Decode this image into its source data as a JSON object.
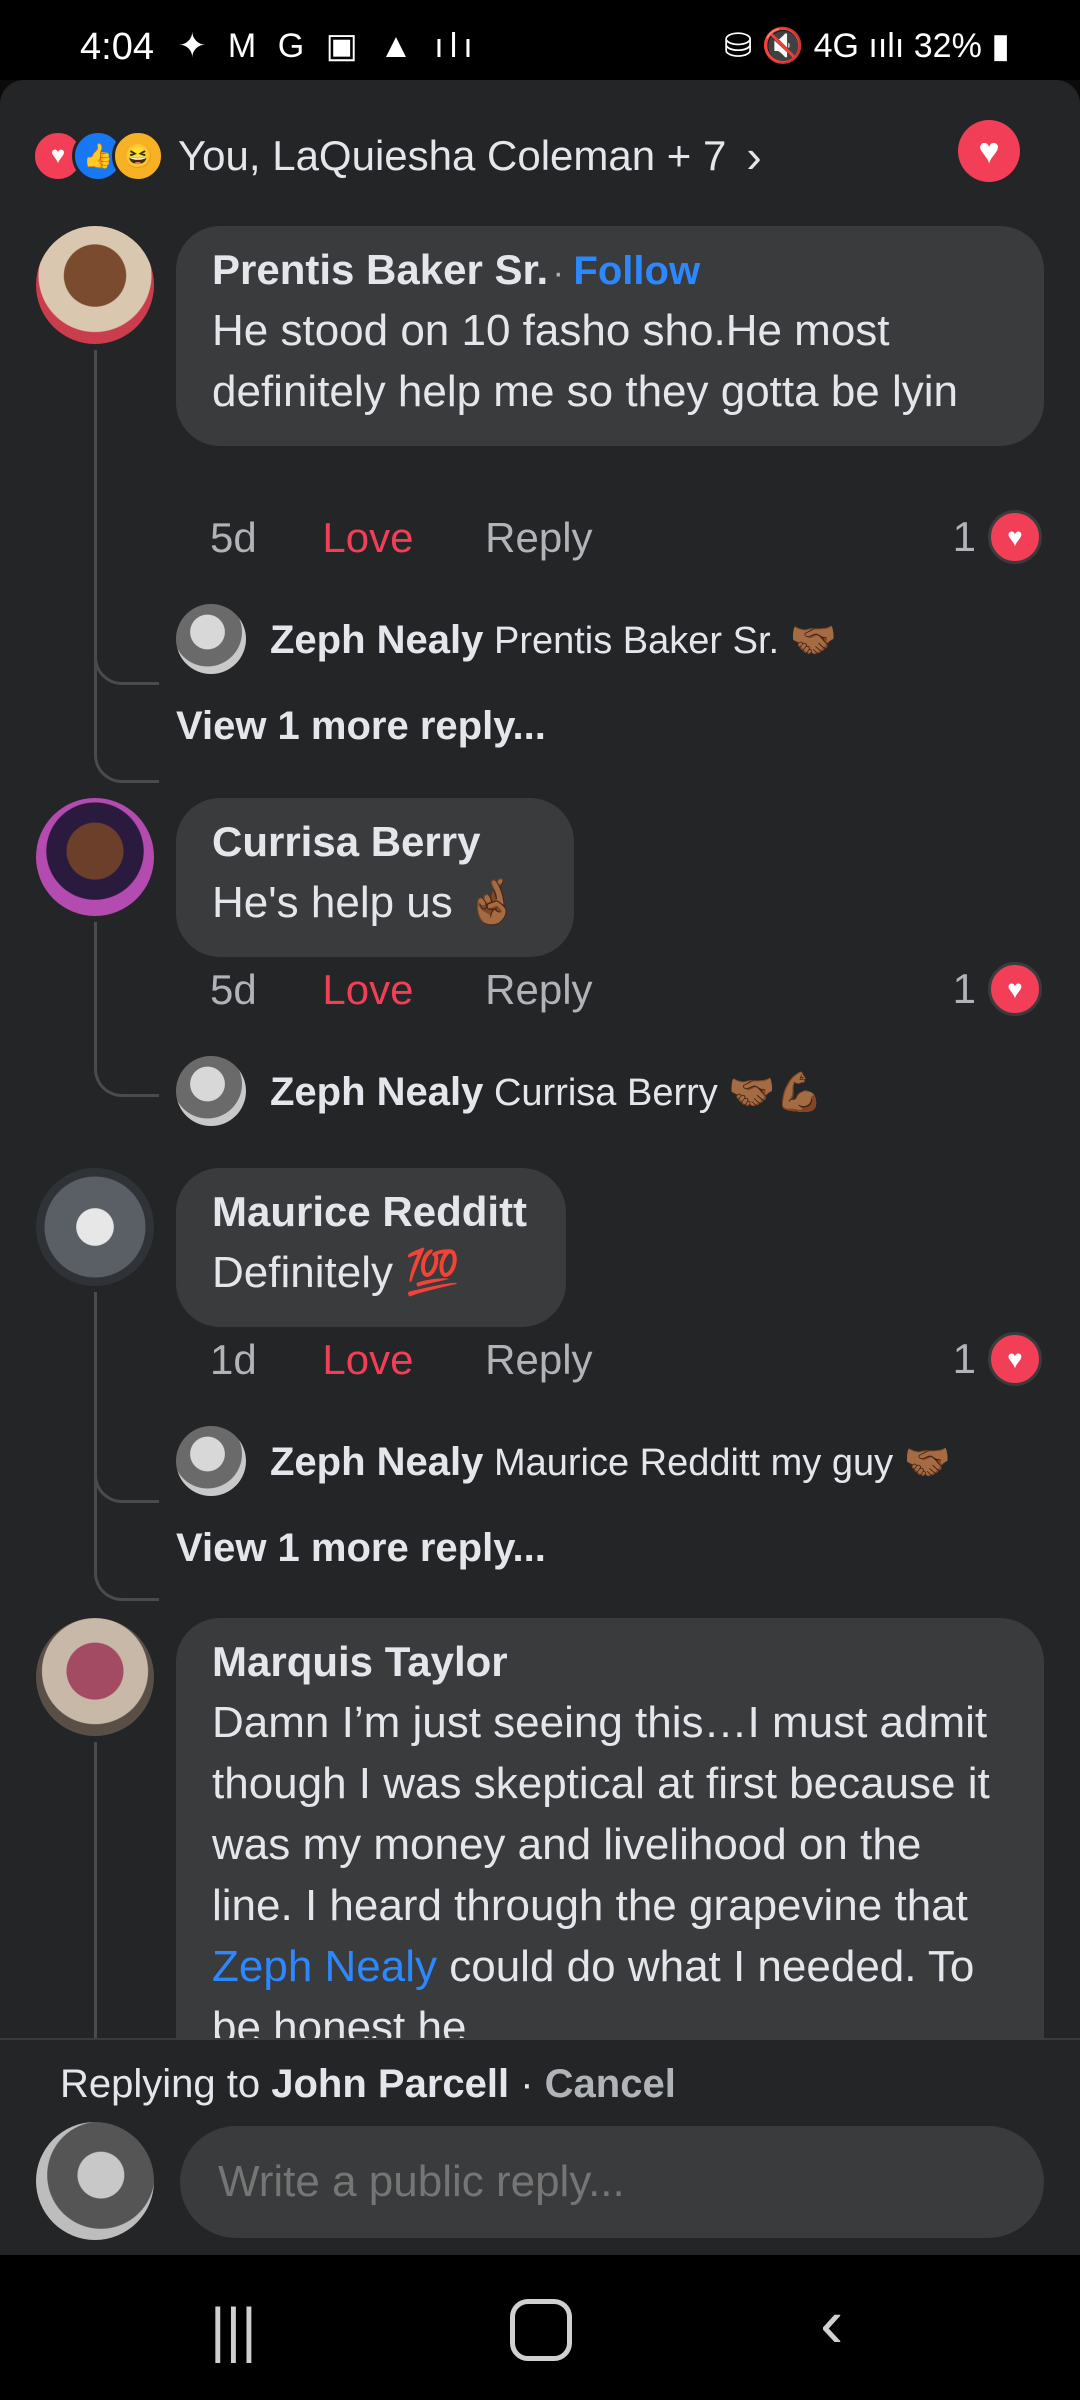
{
  "status": {
    "time": "4:04",
    "left_icons": "✦ M G ▣ ▲ ılı",
    "right_icons": "⛁ 🔇 4G ıılı",
    "battery": "32%"
  },
  "reactions": {
    "names": "You, LaQuiesha Coleman + 7"
  },
  "comments": [
    {
      "author": "Prentis Baker Sr.",
      "follow": "Follow",
      "text": "He stood on 10 fasho sho.He most definitely help me so they gotta be lyin",
      "time": "5d",
      "love": "Love",
      "reply": "Reply",
      "count": "1",
      "reply_preview": {
        "author": "Zeph Nealy",
        "text": "Prentis Baker Sr. 🤝🏾"
      },
      "view_more": "View 1 more reply..."
    },
    {
      "author": "Currisa Berry",
      "text": "He's help us 🤞🏾",
      "time": "5d",
      "love": "Love",
      "reply": "Reply",
      "count": "1",
      "reply_preview": {
        "author": "Zeph Nealy",
        "text": "Currisa Berry 🤝🏾💪🏾"
      }
    },
    {
      "author": "Maurice Redditt",
      "text": "Definitely 💯",
      "time": "1d",
      "love": "Love",
      "reply": "Reply",
      "count": "1",
      "reply_preview": {
        "author": "Zeph Nealy",
        "text": "Maurice Redditt  my guy 🤝🏾"
      },
      "view_more": "View 1 more reply..."
    },
    {
      "author": "Marquis Taylor",
      "text_before": "Damn I’m just seeing this…I must admit though I was skeptical at first because it was my money and livelihood on the line. I heard through the grapevine that ",
      "mention": "Zeph Nealy",
      "text_after": " could do what I needed. To be honest he"
    }
  ],
  "footer": {
    "replying_prefix": "Replying to ",
    "replying_to": "John Parcell",
    "separator": " · ",
    "cancel": "Cancel",
    "placeholder": "Write a public reply..."
  },
  "colors": {
    "accent": "#2d88ff",
    "love": "#f33e58",
    "surface": "#242526",
    "bubble": "#3a3b3c"
  }
}
